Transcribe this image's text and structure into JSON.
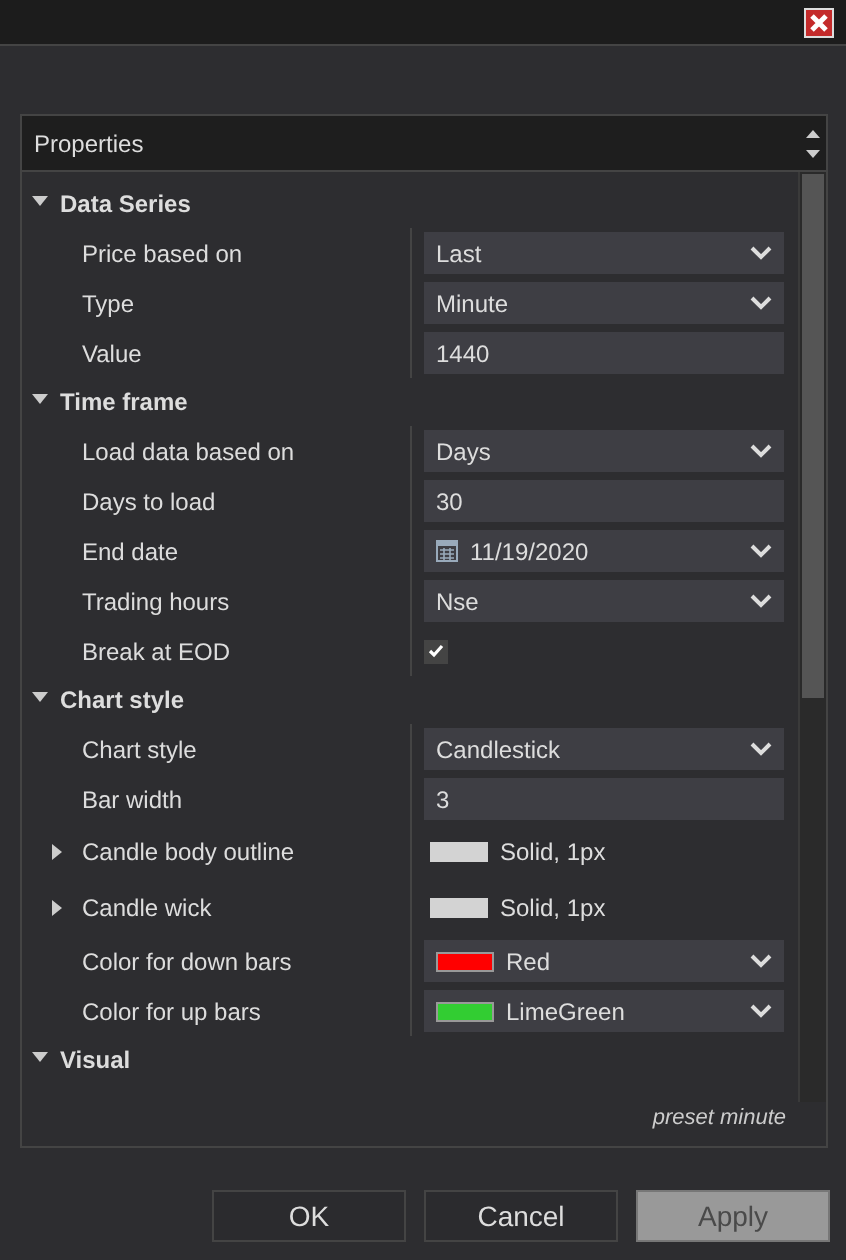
{
  "panel": {
    "title": "Properties",
    "footer": "preset minute"
  },
  "categories": [
    {
      "name": "Data Series",
      "expanded": true,
      "properties": [
        {
          "label": "Price based on",
          "kind": "dropdown",
          "value": "Last"
        },
        {
          "label": "Type",
          "kind": "dropdown",
          "value": "Minute"
        },
        {
          "label": "Value",
          "kind": "text",
          "value": "1440"
        }
      ]
    },
    {
      "name": "Time frame",
      "expanded": true,
      "properties": [
        {
          "label": "Load data based on",
          "kind": "dropdown",
          "value": "Days"
        },
        {
          "label": "Days to load",
          "kind": "text",
          "value": "30"
        },
        {
          "label": "End date",
          "kind": "date",
          "value": "11/19/2020"
        },
        {
          "label": "Trading hours",
          "kind": "dropdown",
          "value": "Nse"
        },
        {
          "label": "Break at EOD",
          "kind": "checkbox",
          "checked": true
        }
      ]
    },
    {
      "name": "Chart style",
      "expanded": true,
      "properties": [
        {
          "label": "Chart style",
          "kind": "dropdown",
          "value": "Candlestick"
        },
        {
          "label": "Bar width",
          "kind": "text",
          "value": "3"
        },
        {
          "label": "Candle body outline",
          "kind": "stroke",
          "expanded": false,
          "value": "Solid, 1px",
          "color": "#d3d3d3"
        },
        {
          "label": "Candle wick",
          "kind": "stroke",
          "expanded": false,
          "value": "Solid, 1px",
          "color": "#d3d3d3"
        },
        {
          "label": "Color for down bars",
          "kind": "color",
          "value": "Red",
          "color": "#ff0000"
        },
        {
          "label": "Color for up bars",
          "kind": "color",
          "value": "LimeGreen",
          "color": "#32cd32"
        }
      ]
    },
    {
      "name": "Visual",
      "expanded": true
    }
  ],
  "buttons": [
    {
      "label": "OK",
      "disabled": false
    },
    {
      "label": "Cancel",
      "disabled": false
    },
    {
      "label": "Apply",
      "disabled": true
    }
  ]
}
